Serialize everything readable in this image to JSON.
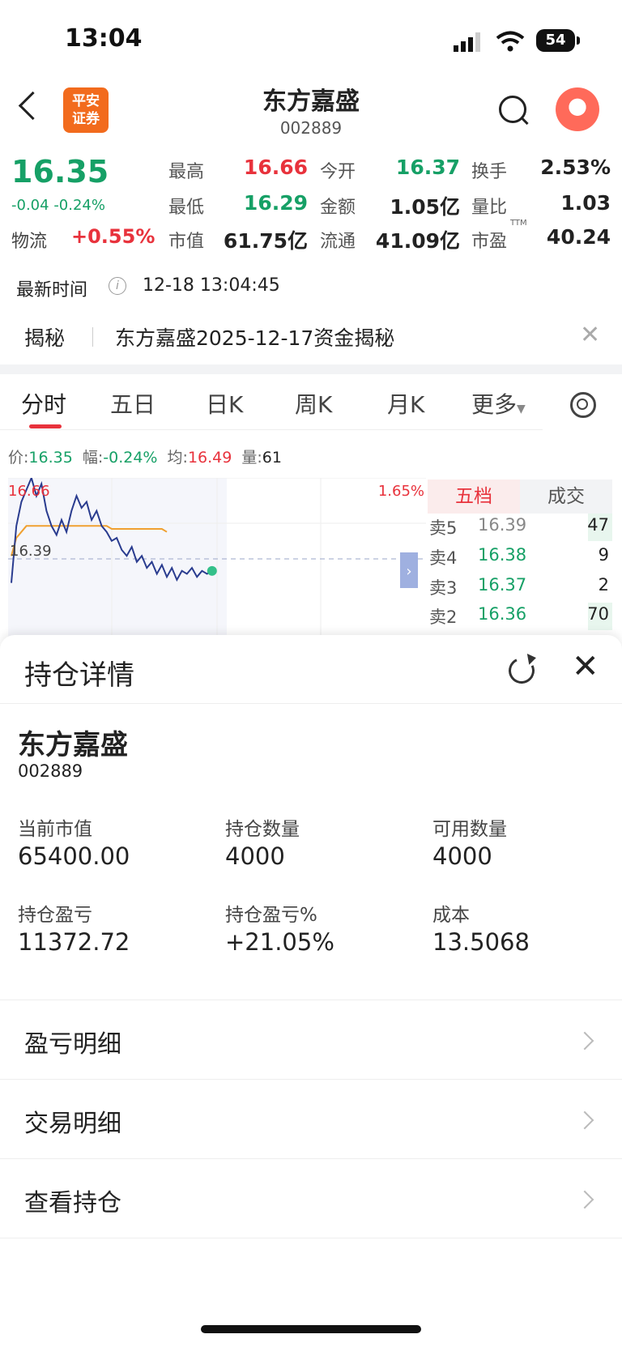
{
  "status": {
    "time": "13:04",
    "battery": "54"
  },
  "header": {
    "logo_line1": "平安",
    "logo_line2": "证券",
    "name": "东方嘉盛",
    "code": "002889"
  },
  "quote": {
    "price": "16.35",
    "change": "-0.04",
    "change_pct": "-0.24%",
    "sector_label": "物流",
    "sector_change": "+0.55%",
    "high_label": "最高",
    "high": "16.66",
    "low_label": "最低",
    "low": "16.29",
    "mcap_label": "市值",
    "mcap": "61.75亿",
    "open_label": "今开",
    "open": "16.37",
    "amount_label": "金额",
    "amount": "1.05亿",
    "float_label": "流通",
    "float": "41.09亿",
    "turnover_label": "换手",
    "turnover": "2.53%",
    "volratio_label": "量比",
    "volratio": "1.03",
    "pe_label": "市盈",
    "pe_sup": "TTM",
    "pe": "40.24"
  },
  "update": {
    "label": "最新时间",
    "value": "12-18 13:04:45"
  },
  "jiemi": {
    "label": "揭秘",
    "text": "东方嘉盛2025-12-17资金揭秘"
  },
  "tabs": [
    "分时",
    "五日",
    "日K",
    "周K",
    "月K",
    "更多"
  ],
  "indicators": {
    "price_label": "价:",
    "price": "16.35",
    "range_label": "幅:",
    "range": "-0.24%",
    "avg_label": "均:",
    "avg": "16.49",
    "vol_label": "量:",
    "vol": "61"
  },
  "chart_data": {
    "type": "line",
    "top_price_label": "16.66",
    "top_pct_label": "1.65%",
    "prev_close_label": "16.39",
    "series": [
      {
        "values": [
          16.31,
          16.5,
          16.58,
          16.62,
          16.66,
          16.6,
          16.64,
          16.55,
          16.5,
          16.47,
          16.52,
          16.48,
          16.55,
          16.6,
          16.56,
          16.58,
          16.52,
          16.55,
          16.5,
          16.48,
          16.45,
          16.46,
          16.42,
          16.4,
          16.43,
          16.38,
          16.4,
          16.36,
          16.38,
          16.34,
          16.37,
          16.33,
          16.36,
          16.32,
          16.35,
          16.34,
          16.36,
          16.33,
          16.35,
          16.34,
          16.35
        ]
      },
      {
        "values": [
          16.4,
          16.46,
          16.48,
          16.5,
          16.5,
          16.5,
          16.5,
          16.5,
          16.5,
          16.5,
          16.5,
          16.5,
          16.5,
          16.5,
          16.5,
          16.5,
          16.5,
          16.5,
          16.5,
          16.5,
          16.49,
          16.49,
          16.49,
          16.49,
          16.49,
          16.49,
          16.49,
          16.49,
          16.49,
          16.49,
          16.49,
          16.48
        ]
      }
    ],
    "ylim": [
      16.12,
      16.66
    ]
  },
  "orderbook": {
    "tab_active": "五档",
    "tab_other": "成交",
    "rows": [
      {
        "label": "卖5",
        "price": "16.39",
        "vol": "47"
      },
      {
        "label": "卖4",
        "price": "16.38",
        "vol": "9"
      },
      {
        "label": "卖3",
        "price": "16.37",
        "vol": "2"
      },
      {
        "label": "卖2",
        "price": "16.36",
        "vol": "70"
      }
    ]
  },
  "sheet": {
    "title": "持仓详情",
    "stock_name": "东方嘉盛",
    "stock_code": "002889",
    "market_value_label": "当前市值",
    "market_value": "65400.00",
    "qty_label": "持仓数量",
    "qty": "4000",
    "avail_label": "可用数量",
    "avail": "4000",
    "pnl_label": "持仓盈亏",
    "pnl": "11372.72",
    "pnl_pct_label": "持仓盈亏%",
    "pnl_pct": "+21.05%",
    "cost_label": "成本",
    "cost": "13.5068",
    "menu": [
      "盈亏明细",
      "交易明细",
      "查看持仓"
    ]
  },
  "colors": {
    "red": "#e8323c",
    "green": "#16a066",
    "brand_orange": "#f26b1d"
  }
}
